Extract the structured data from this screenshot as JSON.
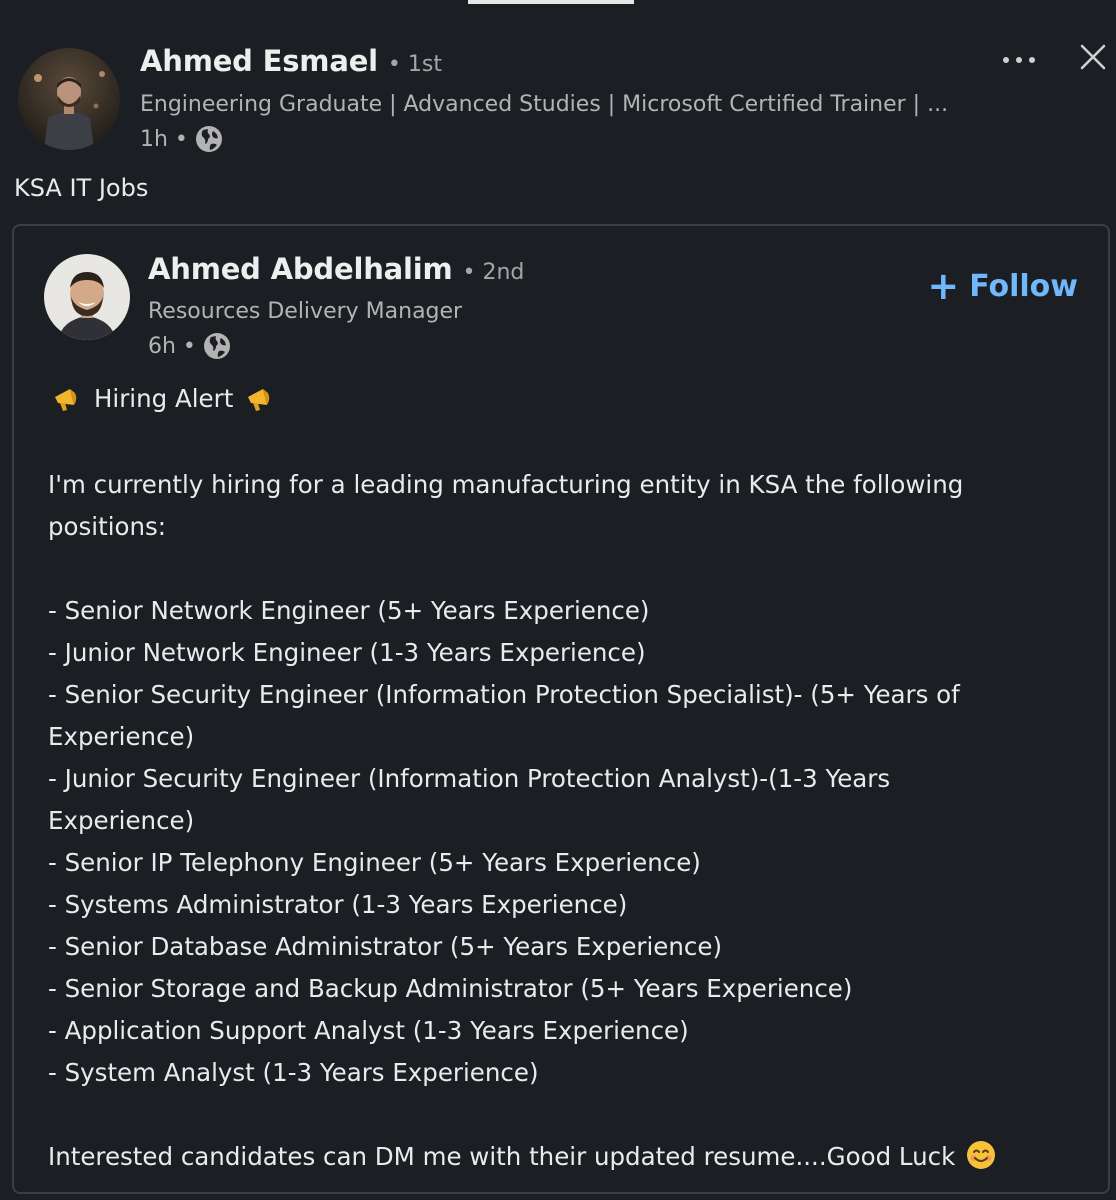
{
  "post": {
    "author_name": "Ahmed Esmael",
    "degree": "• 1st",
    "headline": "Engineering Graduate | Advanced Studies | Microsoft Certified Trainer | ...",
    "time": "1h •",
    "commentary": "KSA IT Jobs",
    "icons": {
      "more": "more-horizontal-icon",
      "close": "close-icon",
      "visibility": "globe-icon"
    }
  },
  "shared": {
    "author_name": "Ahmed Abdelhalim",
    "degree": "• 2nd",
    "headline": "Resources Delivery Manager",
    "time": "6h •",
    "follow_label": "Follow",
    "follow_plus": "+",
    "accent_color": "#71b7fb",
    "alert_title": "Hiring Alert",
    "intro_line1": "I'm currently hiring for a leading manufacturing entity in KSA the following",
    "intro_line2": "positions:",
    "positions": [
      "- Senior Network Engineer (5+ Years Experience)",
      "- Junior Network Engineer (1-3 Years Experience)",
      "- Senior Security Engineer (Information Protection Specialist)- (5+ Years of",
      "Experience)",
      "- Junior Security Engineer (Information Protection Analyst)-(1-3 Years",
      "Experience)",
      "- Senior IP Telephony Engineer (5+ Years Experience)",
      "- Systems Administrator (1-3 Years Experience)",
      "- Senior Database Administrator (5+ Years Experience)",
      "- Senior Storage and Backup Administrator (5+ Years Experience)",
      "- Application Support Analyst (1-3 Years Experience)",
      "- System Analyst (1-3 Years Experience)"
    ],
    "closing": "Interested candidates can DM me with their updated resume....Good Luck"
  }
}
